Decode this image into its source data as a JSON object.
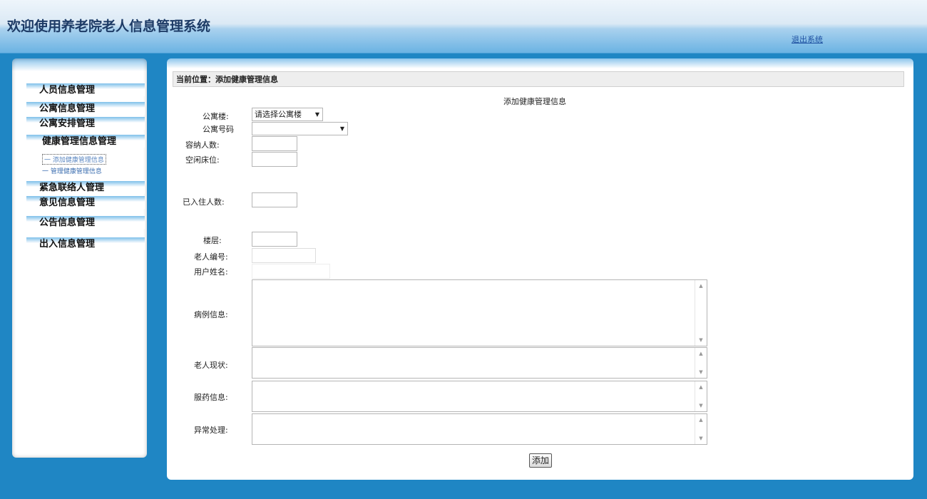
{
  "header": {
    "title": "欢迎使用养老院老人信息管理系统",
    "logout_label": "退出系统"
  },
  "sidebar": {
    "items": [
      {
        "label": "人员信息管理"
      },
      {
        "label": "公寓信息管理"
      },
      {
        "label": "公寓安排管理"
      },
      {
        "label": "健康管理信息管理"
      },
      {
        "label": "紧急联络人管理"
      },
      {
        "label": "意见信息管理"
      },
      {
        "label": "公告信息管理"
      },
      {
        "label": "出入信息管理"
      }
    ],
    "submenu": [
      {
        "label": "一 添加健康管理信息"
      },
      {
        "label": "一 管理健康管理信息"
      }
    ]
  },
  "main": {
    "breadcrumb": "当前位置：添加健康管理信息",
    "form_title": "添加健康管理信息",
    "fields": {
      "building_label": "公寓楼:",
      "building_value": "请选择公寓楼",
      "room_label": "公寓号码",
      "room_value": "",
      "capacity_label": "容纳人数:",
      "vacant_label": "空闲床位:",
      "occupied_label": "已入住人数:",
      "floor_label": "楼层:",
      "elder_id_label": "老人编号:",
      "username_label": "用户姓名:",
      "medical_label": "病例信息:",
      "status_label": "老人现状:",
      "medication_label": "服药信息:",
      "exception_label": "异常处理:"
    },
    "submit_label": "添加"
  }
}
